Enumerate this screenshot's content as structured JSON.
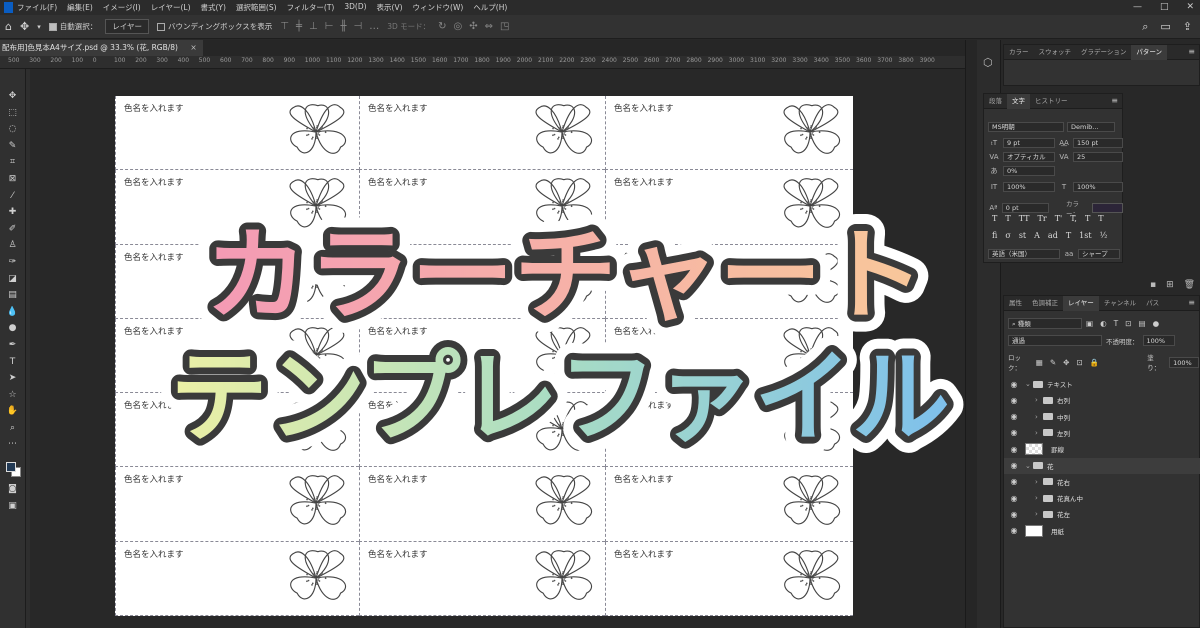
{
  "menubar": {
    "items": [
      "ファイル(F)",
      "編集(E)",
      "イメージ(I)",
      "レイヤー(L)",
      "書式(Y)",
      "選択範囲(S)",
      "フィルター(T)",
      "3D(D)",
      "表示(V)",
      "ウィンドウ(W)",
      "ヘルプ(H)"
    ],
    "window_controls": [
      "—",
      "□",
      "✕"
    ]
  },
  "options": {
    "auto_select_label": "自動選択：",
    "auto_select_target": "レイヤー",
    "bbox_label": "バウンディングボックスを表示",
    "mode_3d_label": "3D モード："
  },
  "document": {
    "tab_title": "配布用]色見本A4サイズ.psd @ 33.3% (花, RGB/8)",
    "close": "×"
  },
  "ruler": {
    "labels": [
      "500",
      "300",
      "200",
      "100",
      "0",
      "100",
      "200",
      "300",
      "400",
      "500",
      "600",
      "700",
      "800",
      "900",
      "1000",
      "1100",
      "1200",
      "1300",
      "1400",
      "1500",
      "1600",
      "1700",
      "1800",
      "1900",
      "2000",
      "2100",
      "2200",
      "2300",
      "2400",
      "2500",
      "2600",
      "2700",
      "2800",
      "2900",
      "3000",
      "3100",
      "3200",
      "3300",
      "3400",
      "3500",
      "3600",
      "3700",
      "3800",
      "3900"
    ]
  },
  "canvas": {
    "card_label": "色名を入れます"
  },
  "overlay": {
    "line1": "カラーチャート",
    "line2": "テンプレファイル",
    "colors": {
      "line1_start": "#f49ab5",
      "line1_end": "#f8c89a",
      "line2_start": "#ecf0a5",
      "line2_mid": "#a8dcc4",
      "line2_end": "#7ec0ec",
      "outline": "#3a3a3a"
    }
  },
  "swatch_panel": {
    "tabs": [
      "カラー",
      "スウォッチ",
      "グラデーション",
      "パターン"
    ],
    "active": "パターン"
  },
  "char_panel": {
    "tabs": [
      "段落",
      "文字",
      "ヒストリー"
    ],
    "active": "文字",
    "font_family": "MS明朝",
    "font_style": "Demib...",
    "size": "9 pt",
    "leading": "150 pt",
    "kerning": "オプティカル",
    "tracking": "25",
    "tsume": "0%",
    "vertical_scale": "100%",
    "horizontal_scale": "100%",
    "baseline": "0 pt",
    "color_label": "カラー：",
    "style_buttons": [
      "T",
      "T",
      "TT",
      "Tr",
      "T'",
      "T,",
      "T",
      "T"
    ],
    "ot_buttons": [
      "fi",
      "σ",
      "st",
      "A",
      "ad",
      "T",
      "1st",
      "½"
    ],
    "language": "英語（米国）",
    "antialias_label": "aa",
    "antialias": "シャープ"
  },
  "layers_panel": {
    "tabs": [
      "属性",
      "色調補正",
      "レイヤー",
      "チャンネル",
      "パス"
    ],
    "active": "レイヤー",
    "filter_kind": "種類",
    "blend_mode": "通過",
    "opacity_label": "不透明度：",
    "opacity": "100%",
    "lock_label": "ロック：",
    "fill_label": "塗り：",
    "fill": "100%",
    "layers": [
      {
        "name": "テキスト",
        "type": "group",
        "level": 0,
        "expanded": true,
        "selected": false
      },
      {
        "name": "右列",
        "type": "group",
        "level": 1,
        "expanded": false,
        "selected": false
      },
      {
        "name": "中列",
        "type": "group",
        "level": 1,
        "expanded": false,
        "selected": false
      },
      {
        "name": "左列",
        "type": "group",
        "level": 1,
        "expanded": false,
        "selected": false
      },
      {
        "name": "罫線",
        "type": "pixel",
        "level": 0,
        "selected": false
      },
      {
        "name": "花",
        "type": "group",
        "level": 0,
        "expanded": true,
        "selected": true
      },
      {
        "name": "花右",
        "type": "group",
        "level": 1,
        "expanded": false,
        "selected": false
      },
      {
        "name": "花真ん中",
        "type": "group",
        "level": 1,
        "expanded": false,
        "selected": false
      },
      {
        "name": "花左",
        "type": "group",
        "level": 1,
        "expanded": false,
        "selected": false
      },
      {
        "name": "用紙",
        "type": "fill",
        "level": 0,
        "selected": false
      }
    ]
  }
}
